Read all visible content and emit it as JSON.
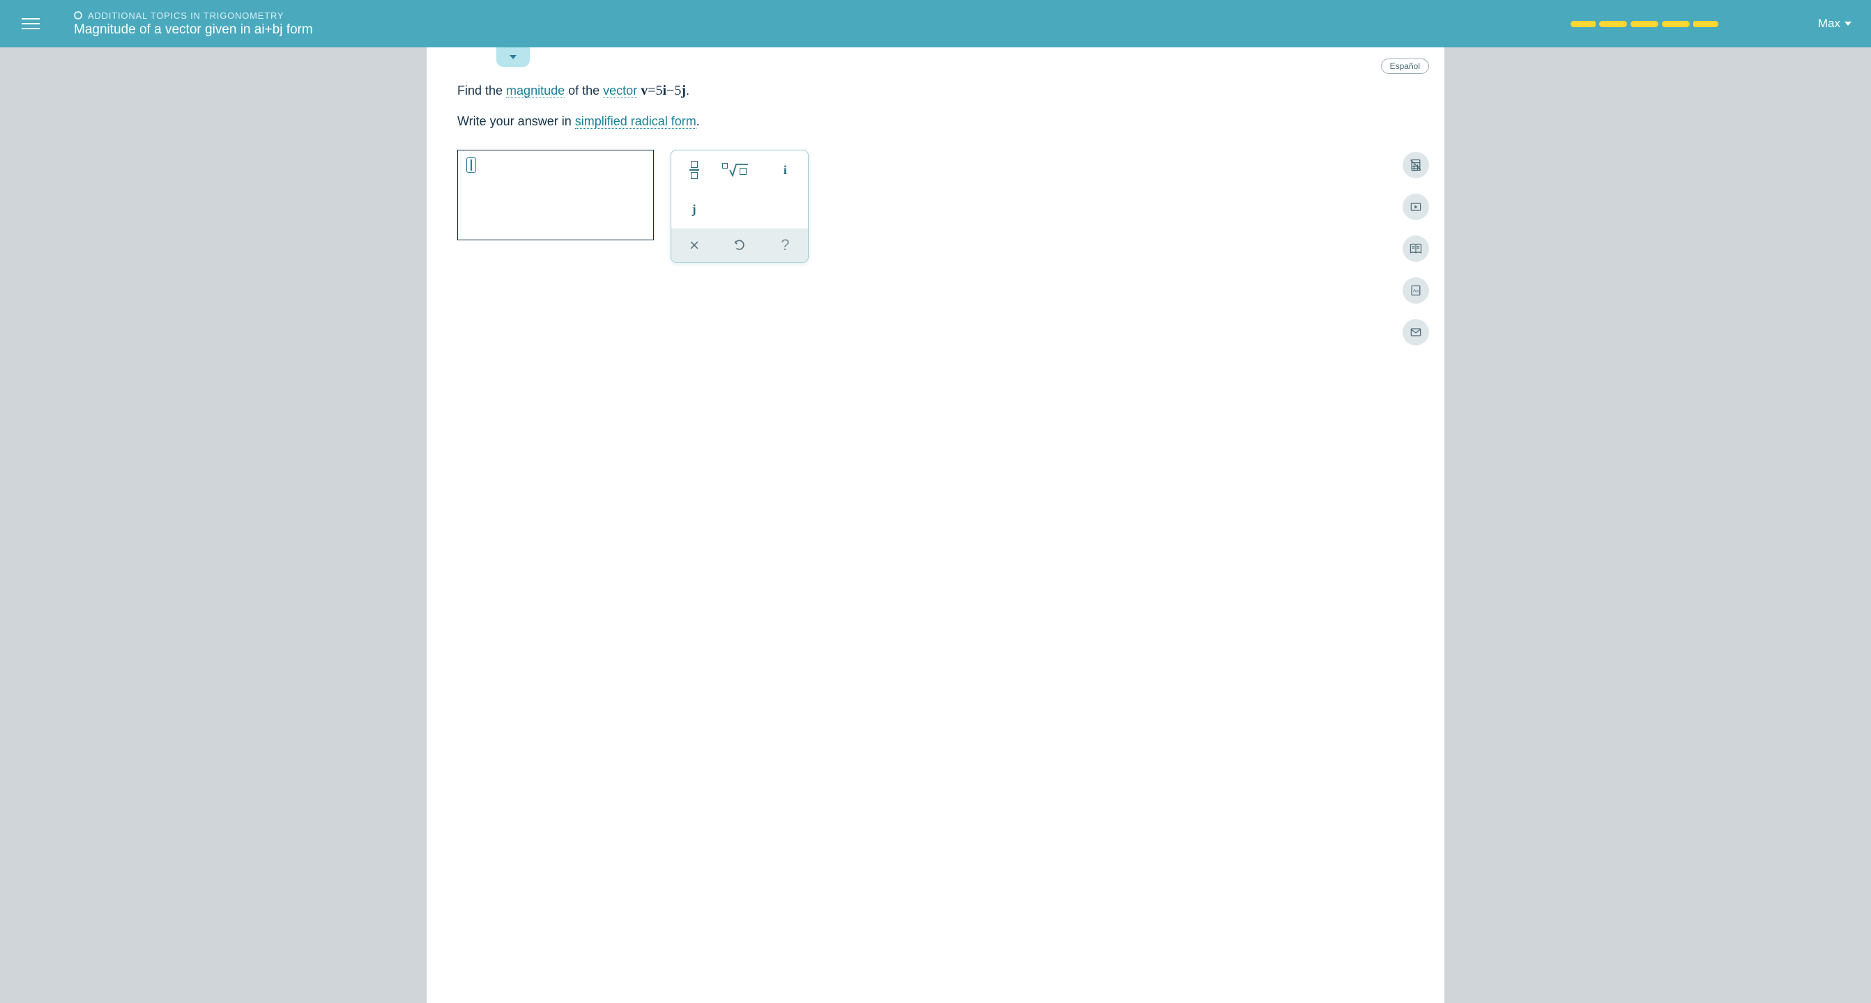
{
  "header": {
    "category": "ADDITIONAL TOPICS IN TRIGONOMETRY",
    "topic": "Magnitude of a vector given in ai+bj form",
    "user": "Max",
    "progress_segments": 5
  },
  "lang_button": "Español",
  "question": {
    "line1_prefix": "Find the ",
    "term1": "magnitude",
    "line1_mid": " of the ",
    "term2": "vector",
    "line1_space": " ",
    "formula_v": "v",
    "formula_eq": "=",
    "formula_a": "5",
    "formula_i": "i",
    "formula_minus": "−",
    "formula_b": "5",
    "formula_j": "j",
    "formula_dot": ".",
    "line2_prefix": "Write your answer in ",
    "term3": "simplified radical form",
    "line2_dot": "."
  },
  "keypad": {
    "i": "i",
    "j": "j",
    "help": "?"
  },
  "side_tools": {
    "calculator": "calculator-icon",
    "video": "video-icon",
    "book": "book-icon",
    "dictionary": "dictionary-icon",
    "mail": "mail-icon"
  }
}
